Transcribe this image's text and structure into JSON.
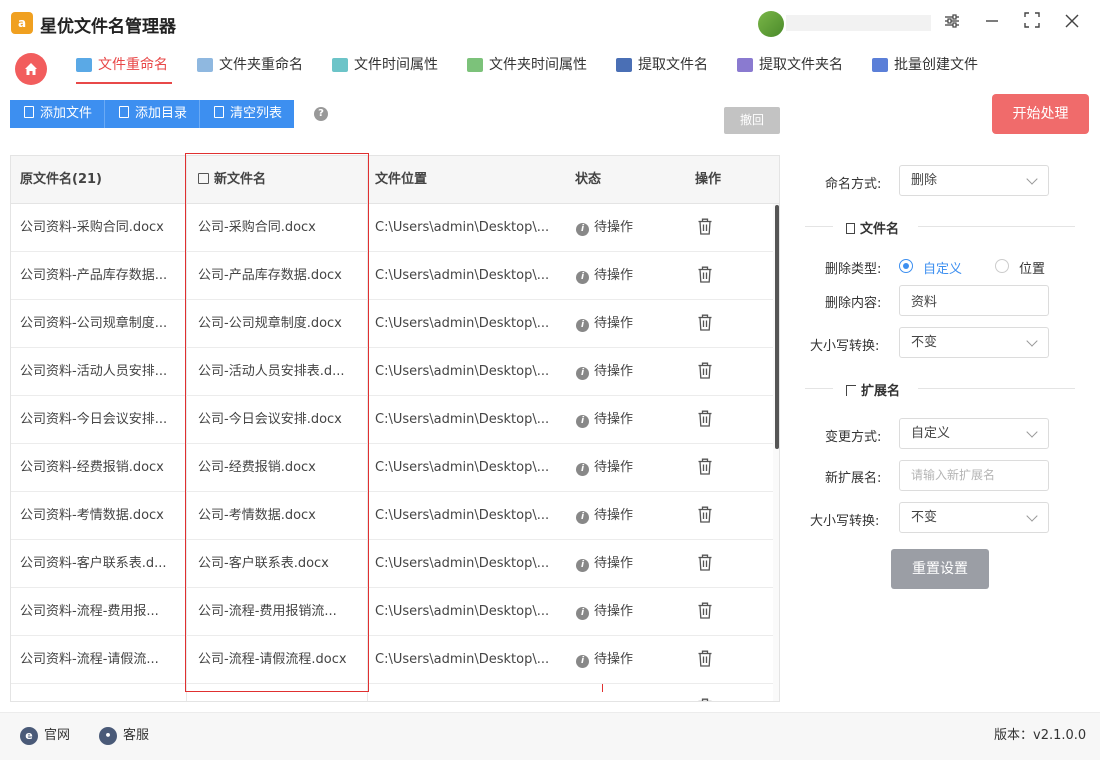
{
  "app": {
    "title": "星优文件名管理器",
    "logo_text": "a"
  },
  "nav": {
    "tabs": [
      {
        "label": "文件重命名",
        "active": true,
        "icon": "file-rename-icon"
      },
      {
        "label": "文件夹重命名",
        "active": false,
        "icon": "folder-rename-icon"
      },
      {
        "label": "文件时间属性",
        "active": false,
        "icon": "file-time-icon"
      },
      {
        "label": "文件夹时间属性",
        "active": false,
        "icon": "folder-time-icon"
      },
      {
        "label": "提取文件名",
        "active": false,
        "icon": "extract-filename-icon"
      },
      {
        "label": "提取文件夹名",
        "active": false,
        "icon": "extract-foldername-icon"
      },
      {
        "label": "批量创建文件",
        "active": false,
        "icon": "batch-create-icon"
      }
    ]
  },
  "toolbar": {
    "add_file": "添加文件",
    "add_dir": "添加目录",
    "clear_list": "清空列表",
    "help": "?",
    "undo": "撤回",
    "start": "开始处理"
  },
  "table": {
    "headers": {
      "original": "原文件名(21)",
      "new_name": "新文件名",
      "location": "文件位置",
      "status": "状态",
      "action": "操作"
    },
    "rows": [
      {
        "original": "公司资料-采购合同.docx",
        "new_name": "公司-采购合同.docx",
        "location": "C:\\Users\\admin\\Desktop\\...",
        "status": "待操作"
      },
      {
        "original": "公司资料-产品库存数据...",
        "new_name": "公司-产品库存数据.docx",
        "location": "C:\\Users\\admin\\Desktop\\...",
        "status": "待操作"
      },
      {
        "original": "公司资料-公司规章制度...",
        "new_name": "公司-公司规章制度.docx",
        "location": "C:\\Users\\admin\\Desktop\\...",
        "status": "待操作"
      },
      {
        "original": "公司资料-活动人员安排...",
        "new_name": "公司-活动人员安排表.d...",
        "location": "C:\\Users\\admin\\Desktop\\...",
        "status": "待操作"
      },
      {
        "original": "公司资料-今日会议安排...",
        "new_name": "公司-今日会议安排.docx",
        "location": "C:\\Users\\admin\\Desktop\\...",
        "status": "待操作"
      },
      {
        "original": "公司资料-经费报销.docx",
        "new_name": "公司-经费报销.docx",
        "location": "C:\\Users\\admin\\Desktop\\...",
        "status": "待操作"
      },
      {
        "original": "公司资料-考情数据.docx",
        "new_name": "公司-考情数据.docx",
        "location": "C:\\Users\\admin\\Desktop\\...",
        "status": "待操作"
      },
      {
        "original": "公司资料-客户联系表.d...",
        "new_name": "公司-客户联系表.docx",
        "location": "C:\\Users\\admin\\Desktop\\...",
        "status": "待操作"
      },
      {
        "original": "公司资料-流程-费用报...",
        "new_name": "公司-流程-费用报销流...",
        "location": "C:\\Users\\admin\\Desktop\\...",
        "status": "待操作"
      },
      {
        "original": "公司资料-流程-请假流...",
        "new_name": "公司-流程-请假流程.docx",
        "location": "C:\\Users\\admin\\Desktop\\...",
        "status": "待操作"
      }
    ]
  },
  "panel": {
    "naming_mode_label": "命名方式:",
    "naming_mode_value": "删除",
    "filename_section": "文件名",
    "delete_type_label": "删除类型:",
    "delete_type_options": [
      "自定义",
      "位置"
    ],
    "delete_content_label": "删除内容:",
    "delete_content_value": "资料",
    "case_label_1": "大小写转换:",
    "case_value_1": "不变",
    "extension_section": "扩展名",
    "change_mode_label": "变更方式:",
    "change_mode_value": "自定义",
    "new_ext_label": "新扩展名:",
    "new_ext_placeholder": "请输入新扩展名",
    "case_label_2": "大小写转换:",
    "case_value_2": "不变",
    "reset": "重置设置"
  },
  "footer": {
    "website": "官网",
    "support": "客服",
    "version": "版本：v2.1.0.0"
  },
  "colors": {
    "accent_red": "#e84848",
    "primary_blue": "#3d8ff0",
    "start_button": "#f06b6b",
    "highlight_box": "#e03030"
  }
}
